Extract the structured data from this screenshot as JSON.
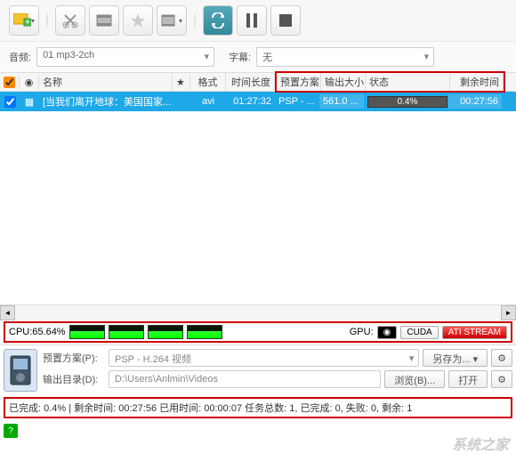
{
  "toolbar": {
    "icons": [
      "add-media",
      "cut",
      "film-merge",
      "star",
      "film-settings",
      "refresh",
      "pause",
      "stop"
    ]
  },
  "audio_selector": {
    "label": "音频:",
    "value": "01 mp3-2ch"
  },
  "subtitle_selector": {
    "label": "字幕:",
    "value": "无"
  },
  "columns": {
    "check": "",
    "film": "",
    "name": "名称",
    "star": "★",
    "format": "格式",
    "duration": "时间长度",
    "preset": "预置方案",
    "size": "输出大小",
    "status": "状态",
    "remain": "剩余时间"
  },
  "row": {
    "checked": "✓",
    "name": "[当我们离开地球：美国国家...",
    "format": "avi",
    "duration": "01:27:32",
    "preset": "PSP - ...",
    "size": "561.0 ...",
    "progress": "0.4%",
    "remain": "00:27:56"
  },
  "cpu": {
    "label": "CPU:65.64%"
  },
  "gpu": {
    "label": "GPU:",
    "cuda": "CUDA",
    "ati": "ATI STREAM"
  },
  "preset": {
    "label": "预置方案(P):",
    "value": "PSP - H.264 视频",
    "save_as": "另存为..."
  },
  "output": {
    "label": "输出目录(D):",
    "value": "D:\\Users\\Anlmin\\Videos",
    "browse": "浏览(B)...",
    "open": "打开"
  },
  "status_bar": "已完成: 0.4% | 剩余时间: 00:27:56 已用时间: 00:00:07 任务总数: 1, 已完成: 0, 失败: 0, 剩余: 1",
  "help": "?"
}
